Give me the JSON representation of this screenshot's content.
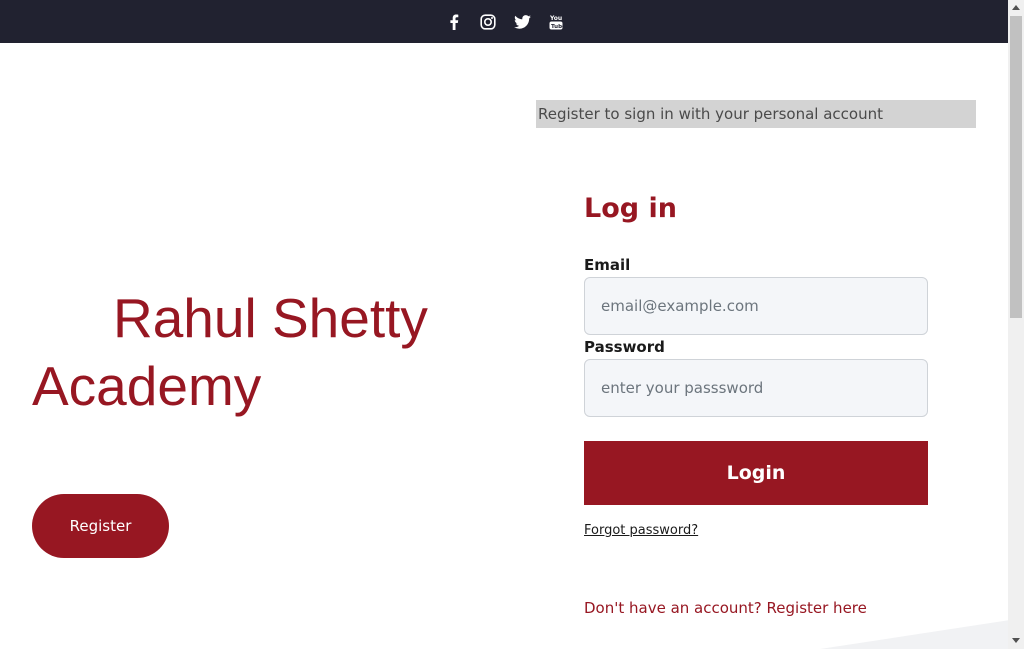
{
  "topbar": {
    "social_icons": [
      "facebook-icon",
      "instagram-icon",
      "twitter-icon",
      "youtube-icon"
    ],
    "background": "#212230"
  },
  "brand": {
    "line1": "Rahul Shetty",
    "line2": "Academy",
    "color": "#971722"
  },
  "left": {
    "register_label": "Register"
  },
  "banner": {
    "text": "Register to sign in with your personal account"
  },
  "login": {
    "title": "Log in",
    "email_label": "Email",
    "email_placeholder": "email@example.com",
    "password_label": "Password",
    "password_placeholder": "enter your passsword",
    "login_label": "Login",
    "forgot_label": "Forgot password?",
    "signup_text": "Don't have an account? Register here"
  },
  "colors": {
    "accent": "#971722",
    "input_bg": "#f4f6f9",
    "banner_bg": "#d3d3d3"
  }
}
